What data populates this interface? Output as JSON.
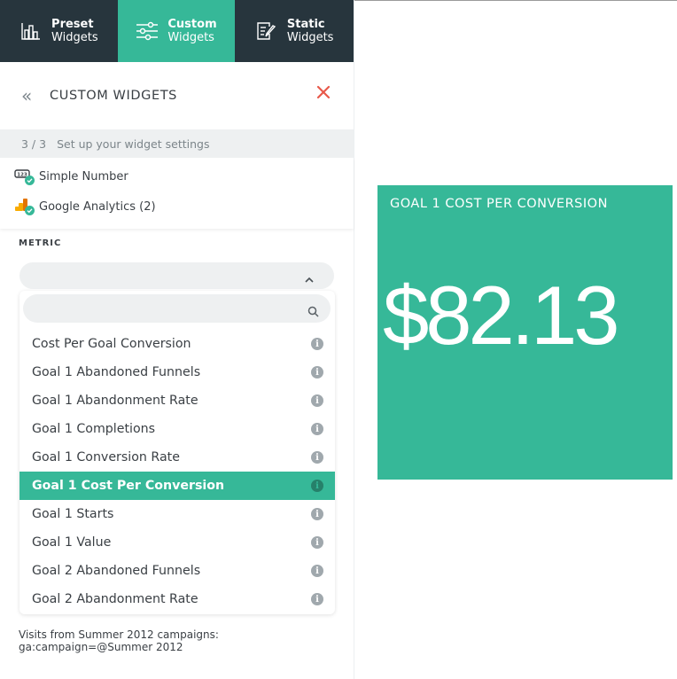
{
  "tabs": [
    {
      "bold": "Preset",
      "label": "Widgets",
      "icon": "bar-chart-icon",
      "active": false
    },
    {
      "bold": "Custom",
      "label": "Widgets",
      "icon": "sliders-icon",
      "active": true
    },
    {
      "bold": "Static",
      "label": "Widgets",
      "icon": "document-edit-icon",
      "active": false
    }
  ],
  "header": {
    "back_icon": "«",
    "title": "CUSTOM WIDGETS",
    "close_icon": "close-icon"
  },
  "step": {
    "number": "3 / 3",
    "text": "Set up your widget settings"
  },
  "selections": [
    {
      "label": "Simple Number",
      "icon": "number-widget-icon",
      "status": "checked"
    },
    {
      "label": "Google Analytics (2)",
      "icon": "google-analytics-icon",
      "status": "checked"
    }
  ],
  "metric": {
    "label": "METRIC",
    "selected_value": "",
    "search_placeholder": "",
    "options": [
      {
        "label": "Cost Per Goal Conversion"
      },
      {
        "label": "Goal 1 Abandoned Funnels"
      },
      {
        "label": "Goal 1 Abandonment Rate"
      },
      {
        "label": "Goal 1 Completions"
      },
      {
        "label": "Goal 1 Conversion Rate"
      },
      {
        "label": "Goal 1 Cost Per Conversion",
        "highlighted": true
      },
      {
        "label": "Goal 1 Starts"
      },
      {
        "label": "Goal 1 Value"
      },
      {
        "label": "Goal 2 Abandoned Funnels"
      },
      {
        "label": "Goal 2 Abandonment Rate"
      }
    ]
  },
  "footnote": {
    "line1": "Visits from Summer 2012 campaigns:",
    "line2": "ga:campaign=@Summer 2012"
  },
  "widget": {
    "title": "GOAL 1 COST PER CONVERSION",
    "value": "$82.13",
    "background": "#36b898"
  },
  "colors": {
    "accent": "#36b898",
    "nav_dark": "#27353d",
    "close": "#e8594a"
  }
}
